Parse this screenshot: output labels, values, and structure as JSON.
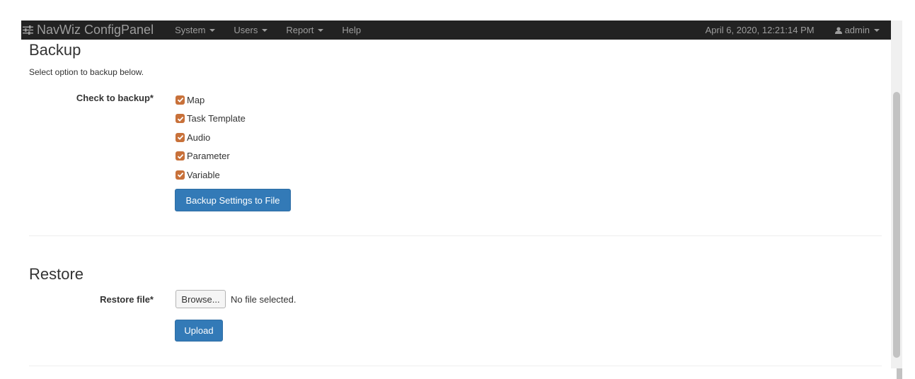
{
  "navbar": {
    "brand": "NavWiz ConfigPanel",
    "brand_icon": "sliders-icon",
    "menu": [
      {
        "label": "System"
      },
      {
        "label": "Users"
      },
      {
        "label": "Report"
      },
      {
        "label": "Help"
      }
    ],
    "datetime": "April 6, 2020, 12:21:14 PM",
    "user": "admin"
  },
  "backup": {
    "title": "Backup",
    "hint": "Select option to backup below.",
    "check_label": "Check to backup*",
    "options": [
      {
        "label": "Map",
        "checked": true
      },
      {
        "label": "Task Template",
        "checked": true
      },
      {
        "label": "Audio",
        "checked": true
      },
      {
        "label": "Parameter",
        "checked": true
      },
      {
        "label": "Variable",
        "checked": true
      }
    ],
    "button": "Backup Settings to File"
  },
  "restore": {
    "title": "Restore",
    "file_label": "Restore file*",
    "browse_label": "Browse...",
    "file_status": "No file selected.",
    "button": "Upload"
  },
  "colors": {
    "navbar": "#222222",
    "primary": "#337ab7",
    "checkbox": "#c8713a"
  }
}
